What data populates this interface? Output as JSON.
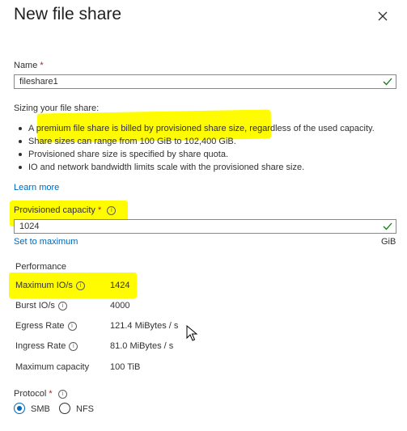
{
  "dialog": {
    "title": "New file share",
    "close_icon": "close-icon"
  },
  "name_field": {
    "label": "Name",
    "required_mark": "*",
    "value": "fileshare1"
  },
  "sizing": {
    "heading": "Sizing your file share:",
    "bullets": [
      "A premium file share is billed by provisioned share size, regardless of the used capacity.",
      "Share sizes can range from 100 GiB to 102,400 GiB.",
      "Provisioned share size is specified by share quota.",
      "IO and network bandwidth limits scale with the provisioned share size."
    ],
    "learn_more": "Learn more"
  },
  "capacity": {
    "label": "Provisioned capacity",
    "required_mark": "*",
    "value": "1024",
    "set_max": "Set to maximum",
    "unit": "GiB"
  },
  "performance": {
    "heading": "Performance",
    "rows": [
      {
        "label": "Maximum IO/s",
        "value": "1424"
      },
      {
        "label": "Burst IO/s",
        "value": "4000"
      },
      {
        "label": "Egress Rate",
        "value": "121.4 MiBytes / s"
      },
      {
        "label": "Ingress Rate",
        "value": "81.0 MiBytes / s"
      },
      {
        "label": "Maximum capacity",
        "value": "100 TiB"
      }
    ]
  },
  "protocol": {
    "label": "Protocol",
    "required_mark": "*",
    "options": [
      "SMB",
      "NFS"
    ],
    "selected": "SMB"
  },
  "colors": {
    "highlight": "#fffb00",
    "link": "#0067b8",
    "check": "#107c10"
  }
}
